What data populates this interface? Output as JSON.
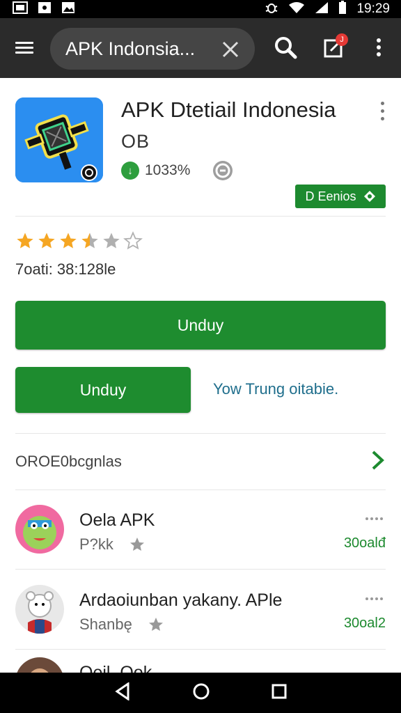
{
  "status_bar": {
    "time": "19:29",
    "left_icons": [
      "image-notification-icon",
      "lock-notification-icon",
      "photo-notification-icon"
    ],
    "right_icons": [
      "bug-icon",
      "wifi-icon",
      "signal-icon",
      "battery-icon"
    ]
  },
  "app_bar": {
    "search_query": "APK Indonsia...",
    "notification_count": "J",
    "icons": [
      "menu-icon",
      "clear-icon",
      "search-icon",
      "edit-icon",
      "more-vert-icon"
    ]
  },
  "app": {
    "title": "APK Dtetiail Indonesia",
    "developer": "OB",
    "stat_value": "1033%",
    "chip_label": "D Eenios",
    "rating_stars": 3.5,
    "rating_text": "7oati: 38:128le",
    "primary_button": "Unduy",
    "secondary_button": "Unduy",
    "link_text": "Yow Trung oitabie."
  },
  "section": {
    "title": "OROE0bcgnlas"
  },
  "list": [
    {
      "title": "Oela APK",
      "subtitle": "P?kk",
      "count": "30oalđ"
    },
    {
      "title": "Ardaoiunban yakany. APle",
      "subtitle": "Shanbę",
      "count": "30oal2"
    },
    {
      "title": "Oeil. Ook",
      "subtitle": "",
      "count": ""
    }
  ],
  "colors": {
    "accent_green": "#1e8c2f",
    "app_bar": "#2b2b2b",
    "link_blue": "#1f6e8c",
    "star_orange": "#f5a623",
    "star_grey": "#b0b0b0"
  }
}
